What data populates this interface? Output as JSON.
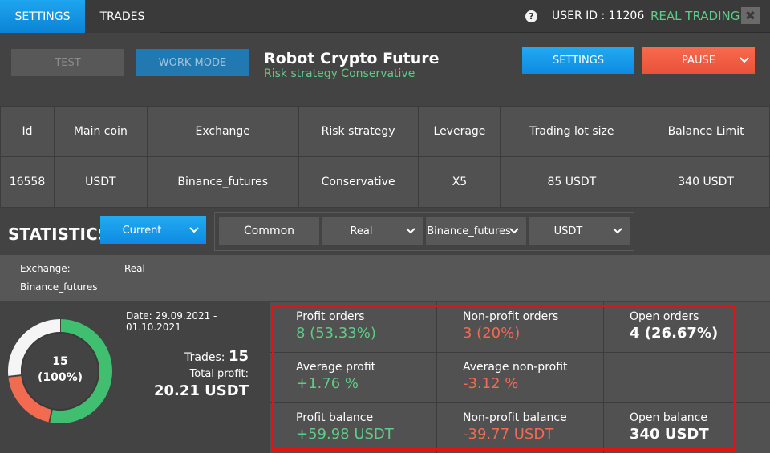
{
  "topbar": {
    "tab_settings": "SETTINGS",
    "tab_trades": "TRADES",
    "help_icon_glyph": "?",
    "user_id": "USER ID : 11206",
    "mode": "REAL TRADING",
    "close_glyph": "✖"
  },
  "controls": {
    "test_label": "TEST",
    "work_mode_label": "WORK MODE",
    "robot_title": "Robot Crypto Future",
    "robot_subtitle": "Risk strategy Conservative",
    "settings_label": "SETTINGS",
    "pause_label": "PAUSE"
  },
  "table": {
    "headers": [
      "Id",
      "Main coin",
      "Exchange",
      "Risk strategy",
      "Leverage",
      "Trading lot size",
      "Balance Limit"
    ],
    "row": [
      "16558",
      "USDT",
      "Binance_futures",
      "Conservative",
      "X5",
      "85 USDT",
      "340 USDT"
    ]
  },
  "statistics": {
    "title": "STATISTICS",
    "period_select": "Current",
    "common_label": "Common",
    "account_select": "Real",
    "exchange_select": "Binance_futures",
    "coin_select": "USDT"
  },
  "info": {
    "exchange_label": "Exchange:",
    "exchange_value": "Binance_futures",
    "account_value": "Real"
  },
  "summary": {
    "donut_count": "15",
    "donut_percent": "(100%)",
    "date": "Date: 29.09.2021 - 01.10.2021",
    "trades_label": "Trades:",
    "trades_value": "15",
    "total_profit_label": "Total profit:",
    "total_profit_value": "20.21 USDT",
    "donut_segments": [
      {
        "name": "profit",
        "value": 53.33,
        "color": "#3fbf6f"
      },
      {
        "name": "non-profit",
        "value": 20,
        "color": "#f26b50"
      },
      {
        "name": "open",
        "value": 26.67,
        "color": "#f5f5f5"
      }
    ]
  },
  "stats": {
    "profit_orders_label": "Profit orders",
    "profit_orders_value": "8 (53.33%)",
    "nonprofit_orders_label": "Non-profit orders",
    "nonprofit_orders_value": "3 (20%)",
    "open_orders_label": "Open orders",
    "open_orders_value": "4 (26.67%)",
    "avg_profit_label": "Average profit",
    "avg_profit_value": "+1.76 %",
    "avg_nonprofit_label": "Average non-profit",
    "avg_nonprofit_value": "-3.12 %",
    "profit_balance_label": "Profit balance",
    "profit_balance_value": "+59.98 USDT",
    "nonprofit_balance_label": "Non-profit balance",
    "nonprofit_balance_value": "-39.77 USDT",
    "open_balance_label": "Open balance",
    "open_balance_value": "340 USDT"
  },
  "colors": {
    "accent_blue": "#1a9cec",
    "profit_green": "#5fcb87",
    "loss_red": "#f26b50",
    "highlight_red": "#e01414"
  }
}
